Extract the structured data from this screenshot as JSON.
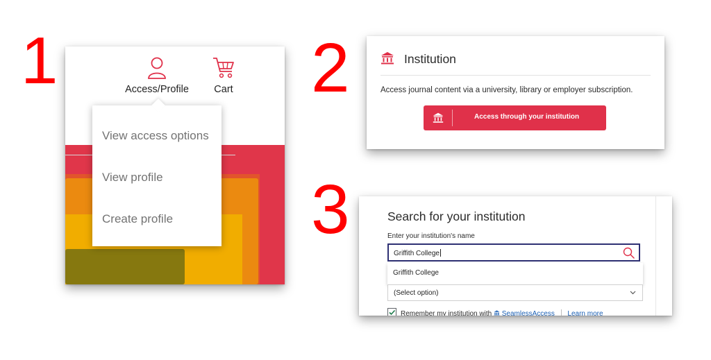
{
  "steps": [
    "1",
    "2",
    "3"
  ],
  "colors": {
    "brand_red": "#e0314a",
    "step_red": "#ff0000",
    "input_border": "#2e3073",
    "link": "#1a5fb4"
  },
  "panel1": {
    "header": {
      "profile_label": "Access/Profile",
      "profile_icon": "user-icon",
      "cart_label": "Cart",
      "cart_icon": "cart-icon"
    },
    "dropdown": {
      "items": [
        {
          "label": "View access options"
        },
        {
          "label": "View profile"
        },
        {
          "label": "Create profile"
        }
      ]
    }
  },
  "panel2": {
    "title": "Institution",
    "title_icon": "institution-icon",
    "description": "Access journal content via a university, library or employer subscription.",
    "button_label": "Access through your institution"
  },
  "panel3": {
    "title": "Search for your institution",
    "input_label": "Enter your institution's name",
    "input_value": "Griffith College",
    "suggestion": "Griffith College",
    "select_value": "(Select option)",
    "remember_text": "Remember my institution with",
    "seamless_label": "SeamlessAccess",
    "learn_more": "Learn more"
  }
}
